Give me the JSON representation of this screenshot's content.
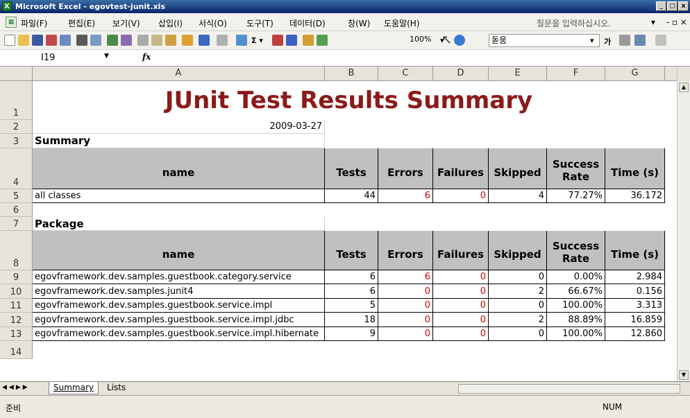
{
  "window": {
    "title": "Microsoft Excel - egovtest-junit.xls",
    "controls": [
      "_",
      "□",
      "x"
    ]
  },
  "menu": {
    "items": [
      "파일(F)",
      "편집(E)",
      "보기(V)",
      "삽입(I)",
      "서식(O)",
      "도구(T)",
      "데이터(D)",
      "창(W)",
      "도움말(H)"
    ],
    "ask_placeholder": "질문을 입력하십시오."
  },
  "toolbar": {
    "zoom": "100%",
    "font": "돋움",
    "bold_label": "가"
  },
  "formula_bar": {
    "name_box": "I19",
    "fx": "fx",
    "formula": ""
  },
  "columns": [
    "A",
    "B",
    "C",
    "D",
    "E",
    "F",
    "G"
  ],
  "rows": [
    "1",
    "2",
    "3",
    "4",
    "5",
    "6",
    "7",
    "8",
    "9",
    "10",
    "11",
    "12",
    "13",
    "14"
  ],
  "sheet": {
    "title": "JUnit Test Results Summary",
    "date": "2009-03-27",
    "summary_label": "Summary",
    "package_label": "Package",
    "headers": {
      "name": "name",
      "tests": "Tests",
      "errors": "Errors",
      "failures": "Failures",
      "skipped": "Skipped",
      "success": "Success Rate",
      "time": "Time (s)"
    },
    "summary_row": {
      "name": "all classes",
      "tests": "44",
      "errors": "6",
      "failures": "0",
      "skipped": "4",
      "success": "77.27%",
      "time": "36.172"
    },
    "packages": [
      {
        "name": "egovframework.dev.samples.guestbook.category.service",
        "tests": "6",
        "errors": "6",
        "failures": "0",
        "skipped": "0",
        "success": "0.00%",
        "time": "2.984"
      },
      {
        "name": "egovframework.dev.samples.junit4",
        "tests": "6",
        "errors": "0",
        "failures": "0",
        "skipped": "2",
        "success": "66.67%",
        "time": "0.156"
      },
      {
        "name": "egovframework.dev.samples.guestbook.service.impl",
        "tests": "5",
        "errors": "0",
        "failures": "0",
        "skipped": "0",
        "success": "100.00%",
        "time": "3.313"
      },
      {
        "name": "egovframework.dev.samples.guestbook.service.impl.jdbc",
        "tests": "18",
        "errors": "0",
        "failures": "0",
        "skipped": "2",
        "success": "88.89%",
        "time": "16.859"
      },
      {
        "name": "egovframework.dev.samples.guestbook.service.impl.hibernate",
        "tests": "9",
        "errors": "0",
        "failures": "0",
        "skipped": "0",
        "success": "100.00%",
        "time": "12.860"
      }
    ]
  },
  "tabs": [
    {
      "label": "Summary",
      "active": true
    },
    {
      "label": "Lists",
      "active": false
    }
  ],
  "status": {
    "ready": "준비",
    "num": "NUM"
  }
}
